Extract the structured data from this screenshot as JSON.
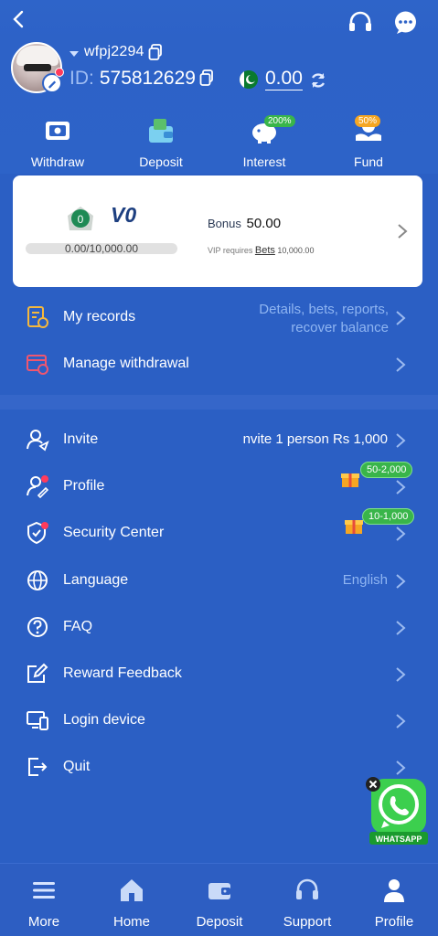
{
  "user": {
    "username": "wfpj2294",
    "id_label": "ID:",
    "id_value": "575812629",
    "balance": "0.00"
  },
  "quick_actions": [
    {
      "label": "Withdraw",
      "icon": "withdraw-icon"
    },
    {
      "label": "Deposit",
      "icon": "deposit-icon"
    },
    {
      "label": "Interest",
      "icon": "piggy-bank-icon",
      "badge": "200%"
    },
    {
      "label": "Fund",
      "icon": "fund-icon",
      "badge": "50%"
    }
  ],
  "vip": {
    "level": "V0",
    "medal_number": "0",
    "progress_text": "0.00/10,000.00",
    "progress_fraction": 0.0,
    "bonus_label": "Bonus",
    "bonus_value": "50.00",
    "requires_prefix": "VIP requires",
    "requires_link": "Bets",
    "requires_value": "10,000.00"
  },
  "menu_top": [
    {
      "label": "My records",
      "icon": "records-icon",
      "right_line1": "Details, bets, reports,",
      "right_line2": "recover balance"
    },
    {
      "label": "Manage withdrawal",
      "icon": "manage-withdrawal-icon"
    }
  ],
  "menu_main": [
    {
      "label": "Invite",
      "icon": "invite-icon",
      "right": "nvite 1 person Rs 1,000"
    },
    {
      "label": "Profile",
      "icon": "profile-edit-icon",
      "gift_badge": "50-2,000"
    },
    {
      "label": "Security Center",
      "icon": "shield-icon",
      "gift_badge": "10-1,000"
    },
    {
      "label": "Language",
      "icon": "globe-icon",
      "right": "English"
    },
    {
      "label": "FAQ",
      "icon": "question-icon"
    },
    {
      "label": "Reward Feedback",
      "icon": "feedback-edit-icon"
    },
    {
      "label": "Login device",
      "icon": "devices-icon"
    },
    {
      "label": "Quit",
      "icon": "logout-icon"
    }
  ],
  "whatsapp_label": "WHATSAPP",
  "bottom_nav": [
    {
      "label": "More",
      "icon": "menu-icon"
    },
    {
      "label": "Home",
      "icon": "home-icon"
    },
    {
      "label": "Deposit",
      "icon": "wallet-icon"
    },
    {
      "label": "Support",
      "icon": "headset-icon"
    },
    {
      "label": "Profile",
      "icon": "user-icon"
    }
  ],
  "colors": {
    "background": "#2b5fc4",
    "accent_text": "#8fb5f2",
    "badge_green": "#39b54a",
    "badge_orange": "#f5a623",
    "notification_red": "#ff3b5c"
  }
}
